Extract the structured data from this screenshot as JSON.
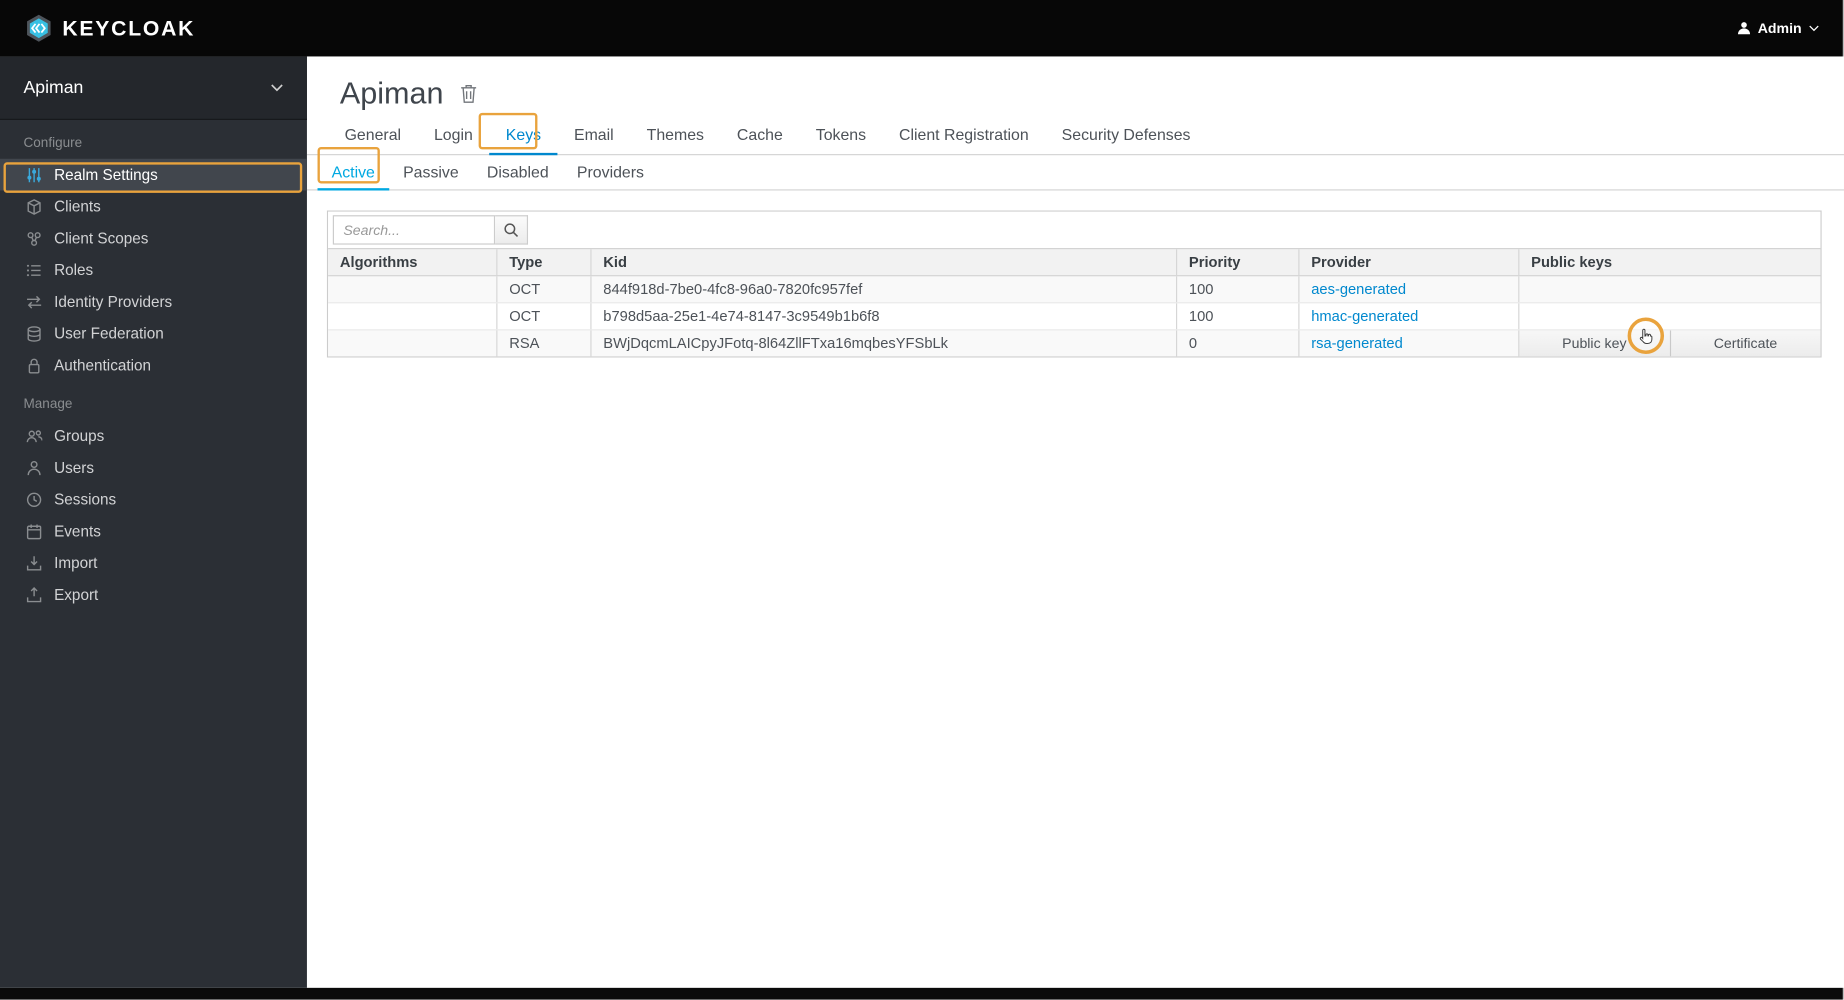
{
  "topbar": {
    "brand": "KEYCLOAK",
    "user_label": "Admin"
  },
  "sidebar": {
    "realm": "Apiman",
    "configure_label": "Configure",
    "manage_label": "Manage",
    "configure_items": [
      {
        "label": "Realm Settings",
        "icon": "sliders",
        "active": true
      },
      {
        "label": "Clients",
        "icon": "cube"
      },
      {
        "label": "Client Scopes",
        "icon": "circles-cluster"
      },
      {
        "label": "Roles",
        "icon": "list"
      },
      {
        "label": "Identity Providers",
        "icon": "exchange-arrows"
      },
      {
        "label": "User Federation",
        "icon": "database"
      },
      {
        "label": "Authentication",
        "icon": "lock"
      }
    ],
    "manage_items": [
      {
        "label": "Groups",
        "icon": "people"
      },
      {
        "label": "Users",
        "icon": "person"
      },
      {
        "label": "Sessions",
        "icon": "clock"
      },
      {
        "label": "Events",
        "icon": "calendar"
      },
      {
        "label": "Import",
        "icon": "tray-arrow-in"
      },
      {
        "label": "Export",
        "icon": "tray-arrow-out"
      }
    ]
  },
  "main": {
    "title": "Apiman",
    "tabs": [
      "General",
      "Login",
      "Keys",
      "Email",
      "Themes",
      "Cache",
      "Tokens",
      "Client Registration",
      "Security Defenses"
    ],
    "active_tab": "Keys",
    "subtabs": [
      "Active",
      "Passive",
      "Disabled",
      "Providers"
    ],
    "active_subtab": "Active",
    "search_placeholder": "Search...",
    "table": {
      "columns": [
        "Algorithms",
        "Type",
        "Kid",
        "Priority",
        "Provider",
        "Public keys"
      ],
      "rows": [
        {
          "algorithms": "",
          "type": "OCT",
          "kid": "844f918d-7be0-4fc8-96a0-7820fc957fef",
          "priority": "100",
          "provider": "aes-generated",
          "actions": []
        },
        {
          "algorithms": "",
          "type": "OCT",
          "kid": "b798d5aa-25e1-4e74-8147-3c9549b1b6f8",
          "priority": "100",
          "provider": "hmac-generated",
          "actions": []
        },
        {
          "algorithms": "",
          "type": "RSA",
          "kid": "BWjDqcmLAICpyJFotq-8l64ZllFTxa16mqbesYFSbLk",
          "priority": "0",
          "provider": "rsa-generated",
          "actions": [
            "Public key",
            "Certificate"
          ]
        }
      ]
    }
  },
  "annotations": {
    "highlight_color": "#e9a33d",
    "highlighted_elements": [
      "Realm Settings",
      "Keys",
      "Active",
      "Public key button cursor"
    ]
  },
  "colors": {
    "topbar_black": "#070707",
    "sidebar_dark": "#2b2f35",
    "link_blue": "#0088ce",
    "active_subtab_blue": "#00a8e1",
    "annotation_orange": "#e9a33d"
  },
  "icons": {
    "keycloak-logo-icon": "hexagon-brand-mark",
    "user-icon": "person-silhouette",
    "chevron-down-icon": "chevron-down",
    "trash-icon": "trash-can",
    "search-icon": "magnifier",
    "cursor-hand-icon": "hand-pointer"
  }
}
